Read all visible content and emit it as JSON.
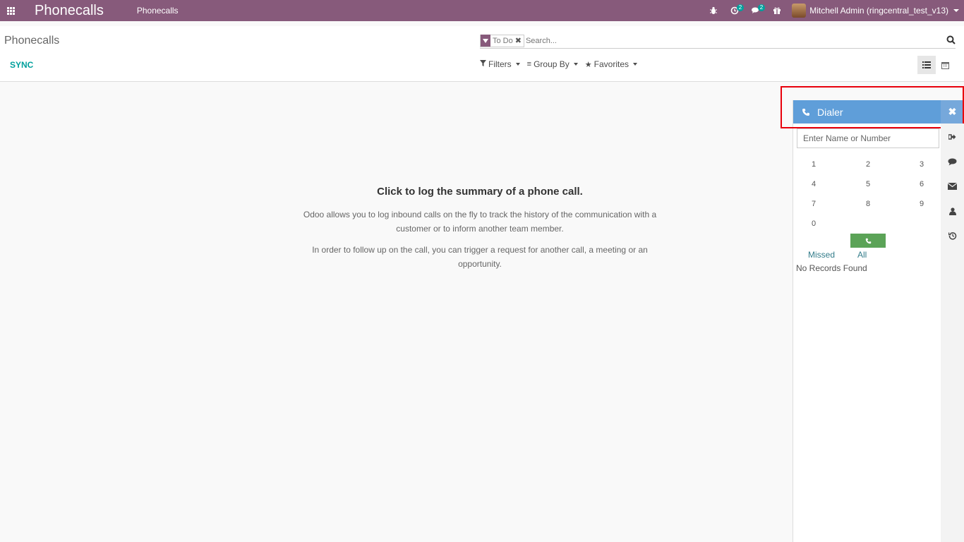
{
  "navbar": {
    "app_title": "Phonecalls",
    "menu_item": "Phonecalls",
    "activity_badge": "2",
    "messages_badge": "2",
    "user_name": "Mitchell Admin (ringcentral_test_v13)"
  },
  "control_panel": {
    "breadcrumb": "Phonecalls",
    "sync_label": "SYNC",
    "search": {
      "facet_value": "To Do",
      "placeholder": "Search..."
    },
    "filters_label": "Filters",
    "group_by_label": "Group By",
    "favorites_label": "Favorites"
  },
  "helper": {
    "title": "Click to log the summary of a phone call.",
    "paragraph1": "Odoo allows you to log inbound calls on the fly to track the history of the communication with a customer or to inform another team member.",
    "paragraph2": "In order to follow up on the call, you can trigger a request for another call, a meeting or an opportunity."
  },
  "dialer": {
    "title": "Dialer",
    "input_placeholder": "Enter Name or Number",
    "keys": [
      "1",
      "2",
      "3",
      "4",
      "5",
      "6",
      "7",
      "8",
      "9",
      "0"
    ],
    "tab_missed": "Missed",
    "tab_all": "All",
    "empty_text": "No Records Found"
  },
  "colors": {
    "navbar": "#875a7b",
    "dialer_header": "#5f9ed9",
    "call_button": "#5ba357",
    "accent_link": "#00a09d",
    "highlight_border": "#e8000b"
  },
  "icons": [
    "apps-icon",
    "bug-icon",
    "activity-icon",
    "messages-icon",
    "gift-icon",
    "search-icon",
    "funnel-icon",
    "list-view-icon",
    "calendar-view-icon",
    "phone-icon",
    "close-icon",
    "signout-icon",
    "chat-icon",
    "envelope-icon",
    "contact-icon",
    "history-icon"
  ]
}
